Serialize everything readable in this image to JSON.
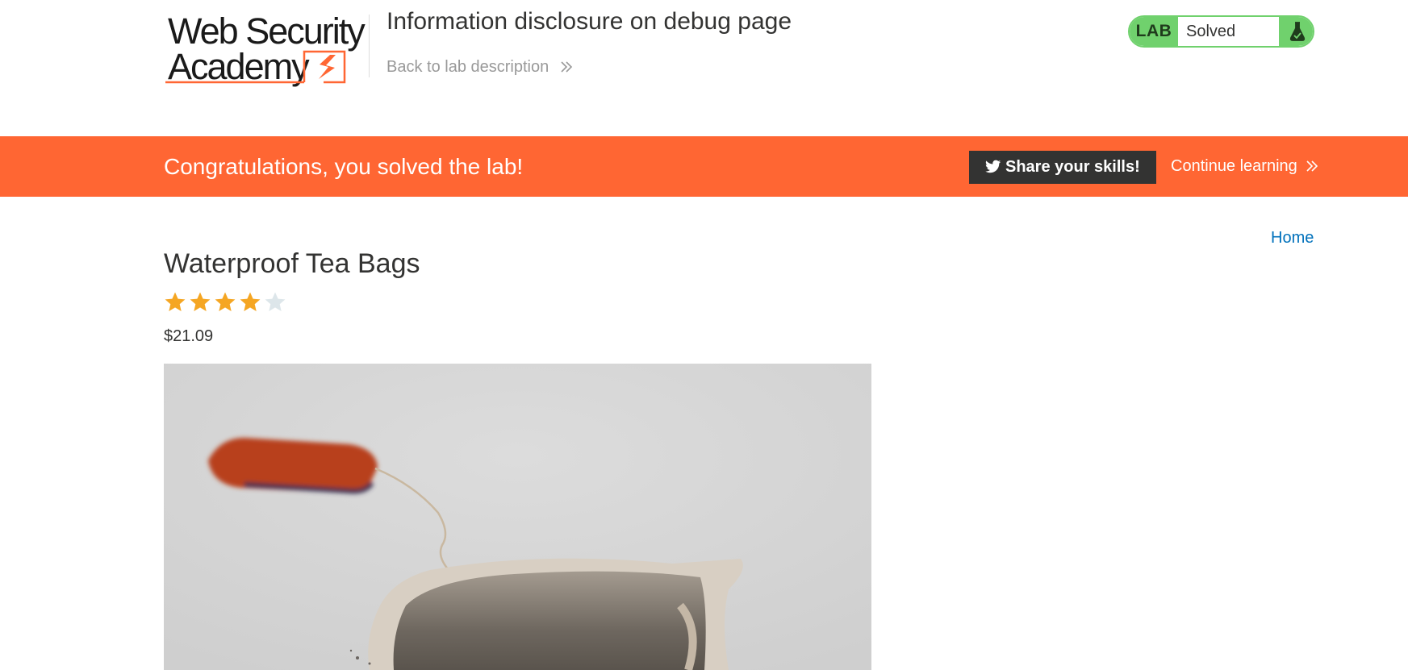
{
  "header": {
    "logo": {
      "line1": "Web Security",
      "line2": "Academy"
    },
    "lab_title": "Information disclosure on debug page",
    "back_link": "Back to lab description",
    "lab_status": {
      "badge": "LAB",
      "state": "Solved",
      "badge_color": "#70d16d"
    }
  },
  "banner": {
    "message": "Congratulations, you solved the lab!",
    "share_button": "Share your skills!",
    "continue_link": "Continue learning",
    "background_color": "#ff6633"
  },
  "nav": {
    "home_link": "Home"
  },
  "product": {
    "title": "Waterproof Tea Bags",
    "rating": 4,
    "rating_max": 5,
    "price": "$21.09",
    "image_alt": "tea-bag-photo"
  },
  "colors": {
    "accent_orange": "#ff6633",
    "star_filled": "#f5a623",
    "star_empty": "#dde6ea",
    "link_blue": "#0071bc",
    "dark": "#333332"
  }
}
